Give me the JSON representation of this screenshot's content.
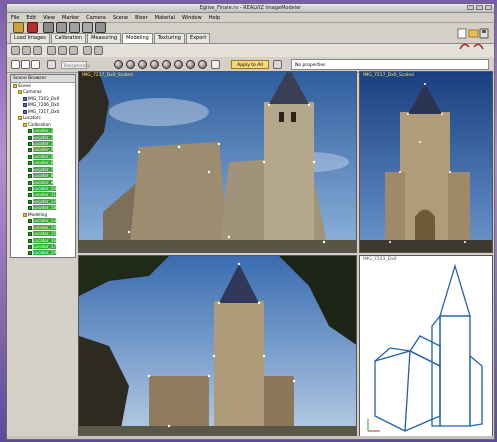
{
  "window": {
    "title": "Eglise_Finale.rv - REALVIZ ImageModeler"
  },
  "menu": [
    "File",
    "Edit",
    "View",
    "Marker",
    "Camera",
    "Scene",
    "Bisor",
    "Material",
    "Window",
    "Help"
  ],
  "tabs": [
    {
      "label": "Load Images",
      "active": false
    },
    {
      "label": "Calibration",
      "active": false
    },
    {
      "label": "Measuring",
      "active": false
    },
    {
      "label": "Modeling",
      "active": true
    },
    {
      "label": "Texturing",
      "active": false
    },
    {
      "label": "Export",
      "active": false
    }
  ],
  "toolbar": {
    "transparency_label": "Transparency",
    "apply_label": "Apply to All Views",
    "properties_text": "No properties"
  },
  "scene_browser": {
    "title": "Scene Browser",
    "nodes": [
      {
        "label": "Scene",
        "type": "folder",
        "indent": 0,
        "selected": false
      },
      {
        "label": "Cameras",
        "type": "folder",
        "indent": 1,
        "selected": false
      },
      {
        "label": "IMG_7203_Dx0",
        "type": "cam",
        "indent": 2,
        "selected": false
      },
      {
        "label": "IMG_7206_Dx0",
        "type": "cam",
        "indent": 2,
        "selected": false
      },
      {
        "label": "IMG_7217_Dx0",
        "type": "cam",
        "indent": 2,
        "selected": false
      },
      {
        "label": "Locators",
        "type": "folder",
        "indent": 1,
        "selected": false
      },
      {
        "label": "Calibration",
        "type": "folder",
        "indent": 2,
        "selected": false
      },
      {
        "label": "Locator_1",
        "type": "loc",
        "indent": 3,
        "selected": true
      },
      {
        "label": "Locator_2",
        "type": "loc",
        "indent": 3,
        "selected": true
      },
      {
        "label": "Locator_3",
        "type": "loc",
        "indent": 3,
        "selected": true
      },
      {
        "label": "Locator_4",
        "type": "loc",
        "indent": 3,
        "selected": true
      },
      {
        "label": "Locator_5",
        "type": "loc",
        "indent": 3,
        "selected": true
      },
      {
        "label": "Locator_6",
        "type": "loc",
        "indent": 3,
        "selected": true
      },
      {
        "label": "Locator_7",
        "type": "loc",
        "indent": 3,
        "selected": true
      },
      {
        "label": "Locator_8",
        "type": "loc",
        "indent": 3,
        "selected": true
      },
      {
        "label": "Locator_9",
        "type": "loc",
        "indent": 3,
        "selected": true
      },
      {
        "label": "Locator_10",
        "type": "loc",
        "indent": 3,
        "selected": true
      },
      {
        "label": "Locator_11",
        "type": "loc",
        "indent": 3,
        "selected": true
      },
      {
        "label": "Locator_12",
        "type": "loc",
        "indent": 3,
        "selected": true
      },
      {
        "label": "Locator_18",
        "type": "loc",
        "indent": 3,
        "selected": true
      },
      {
        "label": "Modeling",
        "type": "folder",
        "indent": 2,
        "selected": false
      },
      {
        "label": "Locator_13",
        "type": "loc",
        "indent": 3,
        "selected": true
      },
      {
        "label": "Locator_14",
        "type": "loc",
        "indent": 3,
        "selected": true
      },
      {
        "label": "Locator_15",
        "type": "loc",
        "indent": 3,
        "selected": true
      },
      {
        "label": "Locator_16",
        "type": "loc",
        "indent": 3,
        "selected": true
      },
      {
        "label": "Locator_17",
        "type": "loc",
        "indent": 3,
        "selected": true
      },
      {
        "label": "Locator_19",
        "type": "loc",
        "indent": 3,
        "selected": true
      },
      {
        "label": "Locator_20",
        "type": "loc",
        "indent": 3,
        "selected": true
      }
    ]
  },
  "viewports": {
    "top_left": "IMG_7217_Dx0_Scaled",
    "top_right": "IMG_7217_Dx0_Scaled",
    "bottom_left": "",
    "bottom_right": "IMG_7203_Dx0"
  },
  "colors": {
    "sky": "#4f7fb8",
    "stone": "#a89a82",
    "locator": "#ffffff",
    "wireframe": "#2060b0",
    "apply_button": "#f4d87a",
    "selection": "#34a934"
  },
  "icons": [
    "new-icon",
    "open-icon",
    "save-icon",
    "undo-icon",
    "redo-icon",
    "select-icon",
    "move-icon",
    "transparency-icon"
  ]
}
